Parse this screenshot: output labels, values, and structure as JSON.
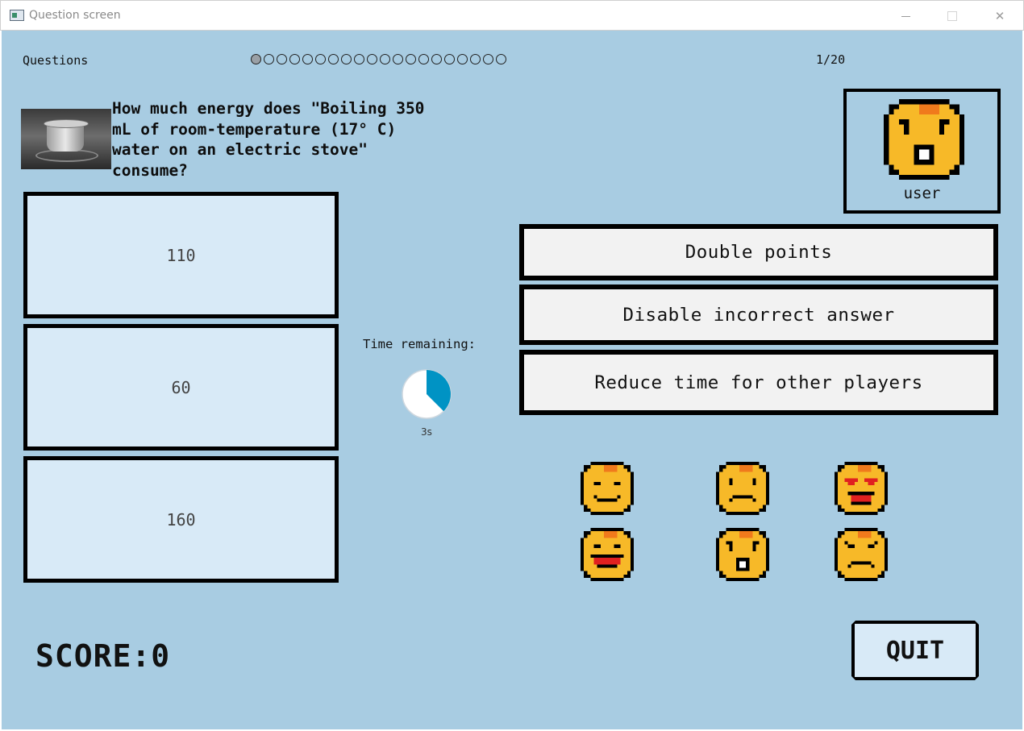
{
  "window": {
    "title": "Question screen",
    "close_glyph": "✕"
  },
  "header": {
    "questions_label": "Questions",
    "counter": "1/20",
    "current_question": 1,
    "total_questions": 20
  },
  "question": {
    "image_icon": "boiling-pot-image",
    "text": "How much energy does \"Boiling 350 mL of room-temperature (17° C) water on an electric stove\" consume?"
  },
  "answers": [
    "110",
    "60",
    "160"
  ],
  "timer": {
    "label": "Time remaining:",
    "value_text": "3s",
    "fraction_remaining": 0.375,
    "fill_color": "#0093c4"
  },
  "player": {
    "name": "user",
    "avatar": "surprised-face-icon"
  },
  "powerups": [
    "Double points",
    "Disable incorrect answer",
    "Reduce time for other players"
  ],
  "emojis": [
    "smiling-face-icon",
    "sad-face-icon",
    "heart-eyes-face-icon",
    "laughing-face-icon",
    "surprised-face-icon",
    "angry-face-icon"
  ],
  "score": {
    "label": "SCORE:0"
  },
  "quit": {
    "label": "QUIT"
  },
  "colors": {
    "background": "#a8cce2",
    "answer_bg": "#d8eaf7",
    "powerup_bg": "#f2f2f2",
    "emoji_yellow": "#f7b928",
    "emoji_orange": "#f07a1c"
  }
}
